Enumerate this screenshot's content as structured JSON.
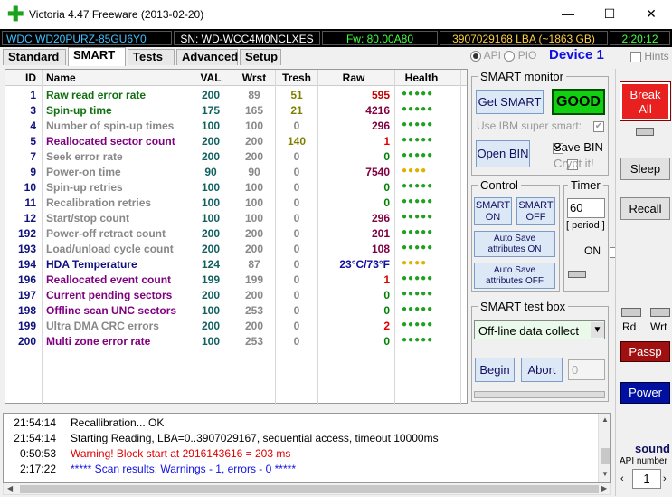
{
  "window": {
    "title": "Victoria 4.47  Freeware (2013-02-20)",
    "minimize": "—",
    "maximize": "☐",
    "close": "✕"
  },
  "infobar": {
    "model": "WDC WD20PURZ-85GU6Y0",
    "serial": "SN: WD-WCC4M0NCLXES",
    "firmware": "Fw: 80.00A80",
    "lba": "3907029168 LBA (~1863 GB)",
    "time": "2:20:12"
  },
  "tabs": [
    {
      "label": "Standard",
      "active": false
    },
    {
      "label": "SMART",
      "active": true
    },
    {
      "label": "Tests",
      "active": false
    },
    {
      "label": "Advanced",
      "active": false
    },
    {
      "label": "Setup",
      "active": false
    }
  ],
  "mode": {
    "api_label": "API",
    "pio_label": "PIO",
    "device_label": "Device 1",
    "hints_label": "Hints"
  },
  "smart_table": {
    "headers": [
      "ID",
      "Name",
      "VAL",
      "Wrst",
      "Tresh",
      "Raw",
      "Health"
    ],
    "rows": [
      {
        "id": "1",
        "name": "Raw read error rate",
        "val": "200",
        "wrst": "89",
        "tresh": "51",
        "raw": "595",
        "health": "●●●●●",
        "name_color": "#107010",
        "raw_color": "#c00000",
        "health_color": "#20a020"
      },
      {
        "id": "3",
        "name": "Spin-up time",
        "val": "175",
        "wrst": "165",
        "tresh": "21",
        "raw": "4216",
        "health": "●●●●●",
        "name_color": "#107010",
        "raw_color": "#800040",
        "health_color": "#20a020"
      },
      {
        "id": "4",
        "name": "Number of spin-up times",
        "val": "100",
        "wrst": "100",
        "tresh": "0",
        "raw": "296",
        "health": "●●●●●",
        "name_color": "#888888",
        "raw_color": "#800040",
        "health_color": "#20a020"
      },
      {
        "id": "5",
        "name": "Reallocated sector count",
        "val": "200",
        "wrst": "200",
        "tresh": "140",
        "raw": "1",
        "health": "●●●●●",
        "name_color": "#800080",
        "raw_color": "#e00000",
        "health_color": "#20a020"
      },
      {
        "id": "7",
        "name": "Seek error rate",
        "val": "200",
        "wrst": "200",
        "tresh": "0",
        "raw": "0",
        "health": "●●●●●",
        "name_color": "#888888",
        "raw_color": "#008000",
        "health_color": "#20a020"
      },
      {
        "id": "9",
        "name": "Power-on time",
        "val": "90",
        "wrst": "90",
        "tresh": "0",
        "raw": "7540",
        "health": "●●●●",
        "name_color": "#888888",
        "raw_color": "#800040",
        "health_color": "#e0b000"
      },
      {
        "id": "10",
        "name": "Spin-up retries",
        "val": "100",
        "wrst": "100",
        "tresh": "0",
        "raw": "0",
        "health": "●●●●●",
        "name_color": "#888888",
        "raw_color": "#008000",
        "health_color": "#20a020"
      },
      {
        "id": "11",
        "name": "Recalibration retries",
        "val": "100",
        "wrst": "100",
        "tresh": "0",
        "raw": "0",
        "health": "●●●●●",
        "name_color": "#888888",
        "raw_color": "#008000",
        "health_color": "#20a020"
      },
      {
        "id": "12",
        "name": "Start/stop count",
        "val": "100",
        "wrst": "100",
        "tresh": "0",
        "raw": "296",
        "health": "●●●●●",
        "name_color": "#888888",
        "raw_color": "#800040",
        "health_color": "#20a020"
      },
      {
        "id": "192",
        "name": "Power-off retract count",
        "val": "200",
        "wrst": "200",
        "tresh": "0",
        "raw": "201",
        "health": "●●●●●",
        "name_color": "#888888",
        "raw_color": "#800040",
        "health_color": "#20a020"
      },
      {
        "id": "193",
        "name": "Load/unload cycle count",
        "val": "200",
        "wrst": "200",
        "tresh": "0",
        "raw": "108",
        "health": "●●●●●",
        "name_color": "#888888",
        "raw_color": "#800040",
        "health_color": "#20a020"
      },
      {
        "id": "194",
        "name": "HDA Temperature",
        "val": "124",
        "wrst": "87",
        "tresh": "0",
        "raw": "23°C/73°F",
        "health": "●●●●",
        "name_color": "#101080",
        "raw_color": "#1010a0",
        "health_color": "#e0b000"
      },
      {
        "id": "196",
        "name": "Reallocated event count",
        "val": "199",
        "wrst": "199",
        "tresh": "0",
        "raw": "1",
        "health": "●●●●●",
        "name_color": "#800080",
        "raw_color": "#e00000",
        "health_color": "#20a020"
      },
      {
        "id": "197",
        "name": "Current pending sectors",
        "val": "200",
        "wrst": "200",
        "tresh": "0",
        "raw": "0",
        "health": "●●●●●",
        "name_color": "#800080",
        "raw_color": "#008000",
        "health_color": "#20a020"
      },
      {
        "id": "198",
        "name": "Offline scan UNC sectors",
        "val": "100",
        "wrst": "253",
        "tresh": "0",
        "raw": "0",
        "health": "●●●●●",
        "name_color": "#800080",
        "raw_color": "#008000",
        "health_color": "#20a020"
      },
      {
        "id": "199",
        "name": "Ultra DMA CRC errors",
        "val": "200",
        "wrst": "200",
        "tresh": "0",
        "raw": "2",
        "health": "●●●●●",
        "name_color": "#888888",
        "raw_color": "#e00000",
        "health_color": "#20a020"
      },
      {
        "id": "200",
        "name": "Multi zone error rate",
        "val": "100",
        "wrst": "253",
        "tresh": "0",
        "raw": "0",
        "health": "●●●●●",
        "name_color": "#800080",
        "raw_color": "#008000",
        "health_color": "#20a020"
      }
    ]
  },
  "smart_monitor": {
    "title": "SMART monitor",
    "get_smart": "Get SMART",
    "status": "GOOD",
    "ibm_label": "Use IBM super smart:",
    "open_bin": "Open BIN",
    "save_bin": "Save BIN",
    "crypt": "Crypt it!"
  },
  "control": {
    "title": "Control",
    "smart_on": "SMART ON",
    "smart_off": "SMART OFF",
    "autosave_on": "Auto Save attributes ON",
    "autosave_off": "Auto Save attributes OFF"
  },
  "timer": {
    "title": "Timer",
    "value": "60",
    "period": "[ period ]",
    "on_label": "ON"
  },
  "test_box": {
    "title": "SMART test box",
    "selected": "Off-line data collect",
    "begin": "Begin",
    "abort": "Abort",
    "count": "0"
  },
  "right": {
    "break_all": "Break All",
    "sleep": "Sleep",
    "recall": "Recall",
    "rd": "Rd",
    "wrt": "Wrt",
    "passp": "Passp",
    "power": "Power",
    "sound": "sound",
    "api_number_label": "API number",
    "api_number": "1"
  },
  "log": [
    {
      "time": "21:54:14",
      "msg": "Recallibration... OK",
      "color": "#000000"
    },
    {
      "time": "21:54:14",
      "msg": "Starting Reading, LBA=0..3907029167, sequential access, timeout 10000ms",
      "color": "#000000"
    },
    {
      "time": "0:50:53",
      "msg": "Warning! Block start at 2916143616 = 203 ms",
      "color": "#e00000"
    },
    {
      "time": "2:17:22",
      "msg": "***** Scan results: Warnings - 1, errors - 0 *****",
      "color": "#1010e0"
    }
  ]
}
